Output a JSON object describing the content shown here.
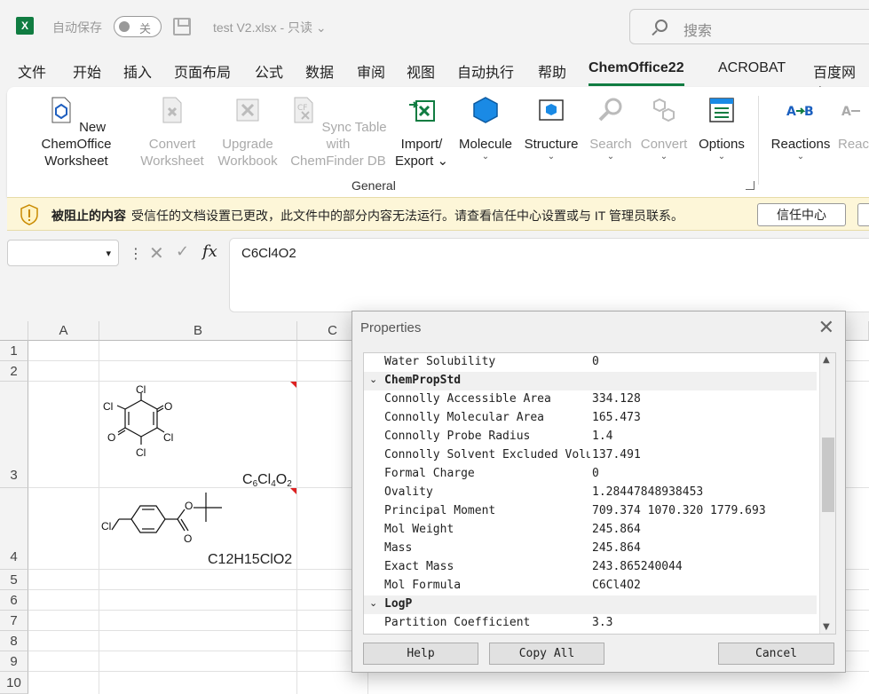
{
  "app": {
    "autosave_label": "自动保存",
    "autosave_state": "关",
    "doc_title": "test V2.xlsx  -  只读 ⌄",
    "search_placeholder": "搜索"
  },
  "menu": [
    "文件",
    "开始",
    "插入",
    "页面布局",
    "公式",
    "数据",
    "审阅",
    "视图",
    "自动执行",
    "帮助",
    "ChemOffice22",
    "ACROBAT",
    "百度网盘"
  ],
  "ribbon": {
    "buttons": [
      {
        "l1": "New ChemOffice",
        "l2": "Worksheet",
        "caret": ""
      },
      {
        "l1": "Convert",
        "l2": "Worksheet",
        "caret": ""
      },
      {
        "l1": "Upgrade",
        "l2": "Workbook",
        "caret": ""
      },
      {
        "l1": "Sync Table with",
        "l2": "ChemFinder DB",
        "caret": ""
      },
      {
        "l1": "Import/",
        "l2": "Export ⌄",
        "caret": ""
      },
      {
        "l1": "Molecule",
        "l2": "",
        "caret": "⌄"
      },
      {
        "l1": "Structure",
        "l2": "",
        "caret": "⌄"
      },
      {
        "l1": "Search",
        "l2": "",
        "caret": "⌄"
      },
      {
        "l1": "Convert",
        "l2": "",
        "caret": "⌄"
      },
      {
        "l1": "Options",
        "l2": "",
        "caret": "⌄"
      },
      {
        "l1": "Reactions",
        "l2": "",
        "caret": "⌄"
      },
      {
        "l1": "Reac",
        "l2": "",
        "caret": ""
      }
    ],
    "group_label": "General"
  },
  "warning": {
    "title": "被阻止的内容",
    "message": "受信任的文档设置已更改，此文件中的部分内容无法运行。请查看信任中心设置或与 IT 管理员联系。",
    "button": "信任中心"
  },
  "formula_bar": {
    "value": "C6Cl4O2"
  },
  "grid": {
    "columns": [
      "A",
      "B",
      "C"
    ],
    "rows": [
      "1",
      "2",
      "3",
      "4",
      "5",
      "6",
      "7",
      "8",
      "9",
      "10"
    ],
    "cell_b4_text": "C12H15ClO2",
    "molecule1_atoms": [
      "Cl",
      "Cl",
      "O",
      "O",
      "Cl",
      "Cl"
    ],
    "molecule2_atoms": [
      "Cl",
      "O",
      "O"
    ]
  },
  "dialog": {
    "title": "Properties",
    "rows": [
      {
        "type": "prop",
        "name": "Water Solubility",
        "value": "0"
      },
      {
        "type": "cat",
        "name": "ChemPropStd",
        "value": ""
      },
      {
        "type": "prop",
        "name": "Connolly Accessible Area",
        "value": "334.128"
      },
      {
        "type": "prop",
        "name": "Connolly Molecular Area",
        "value": "165.473"
      },
      {
        "type": "prop",
        "name": "Connolly Probe Radius",
        "value": "1.4"
      },
      {
        "type": "prop",
        "name": "Connolly Solvent Excluded Volume",
        "value": "137.491"
      },
      {
        "type": "prop",
        "name": "Formal Charge",
        "value": "0"
      },
      {
        "type": "prop",
        "name": "Ovality",
        "value": "1.28447848938453"
      },
      {
        "type": "prop",
        "name": "Principal Moment",
        "value": "709.374 1070.320 1779.693"
      },
      {
        "type": "prop",
        "name": "Mol Weight",
        "value": "245.864"
      },
      {
        "type": "prop",
        "name": "Mass",
        "value": "245.864"
      },
      {
        "type": "prop",
        "name": "Exact Mass",
        "value": "243.865240044"
      },
      {
        "type": "prop",
        "name": "Mol Formula",
        "value": "C6Cl4O2"
      },
      {
        "type": "cat",
        "name": "LogP",
        "value": ""
      },
      {
        "type": "prop",
        "name": "Partition Coefficient",
        "value": "3.3"
      }
    ],
    "buttons": {
      "help": "Help",
      "copy_all": "Copy All",
      "cancel": "Cancel"
    }
  }
}
